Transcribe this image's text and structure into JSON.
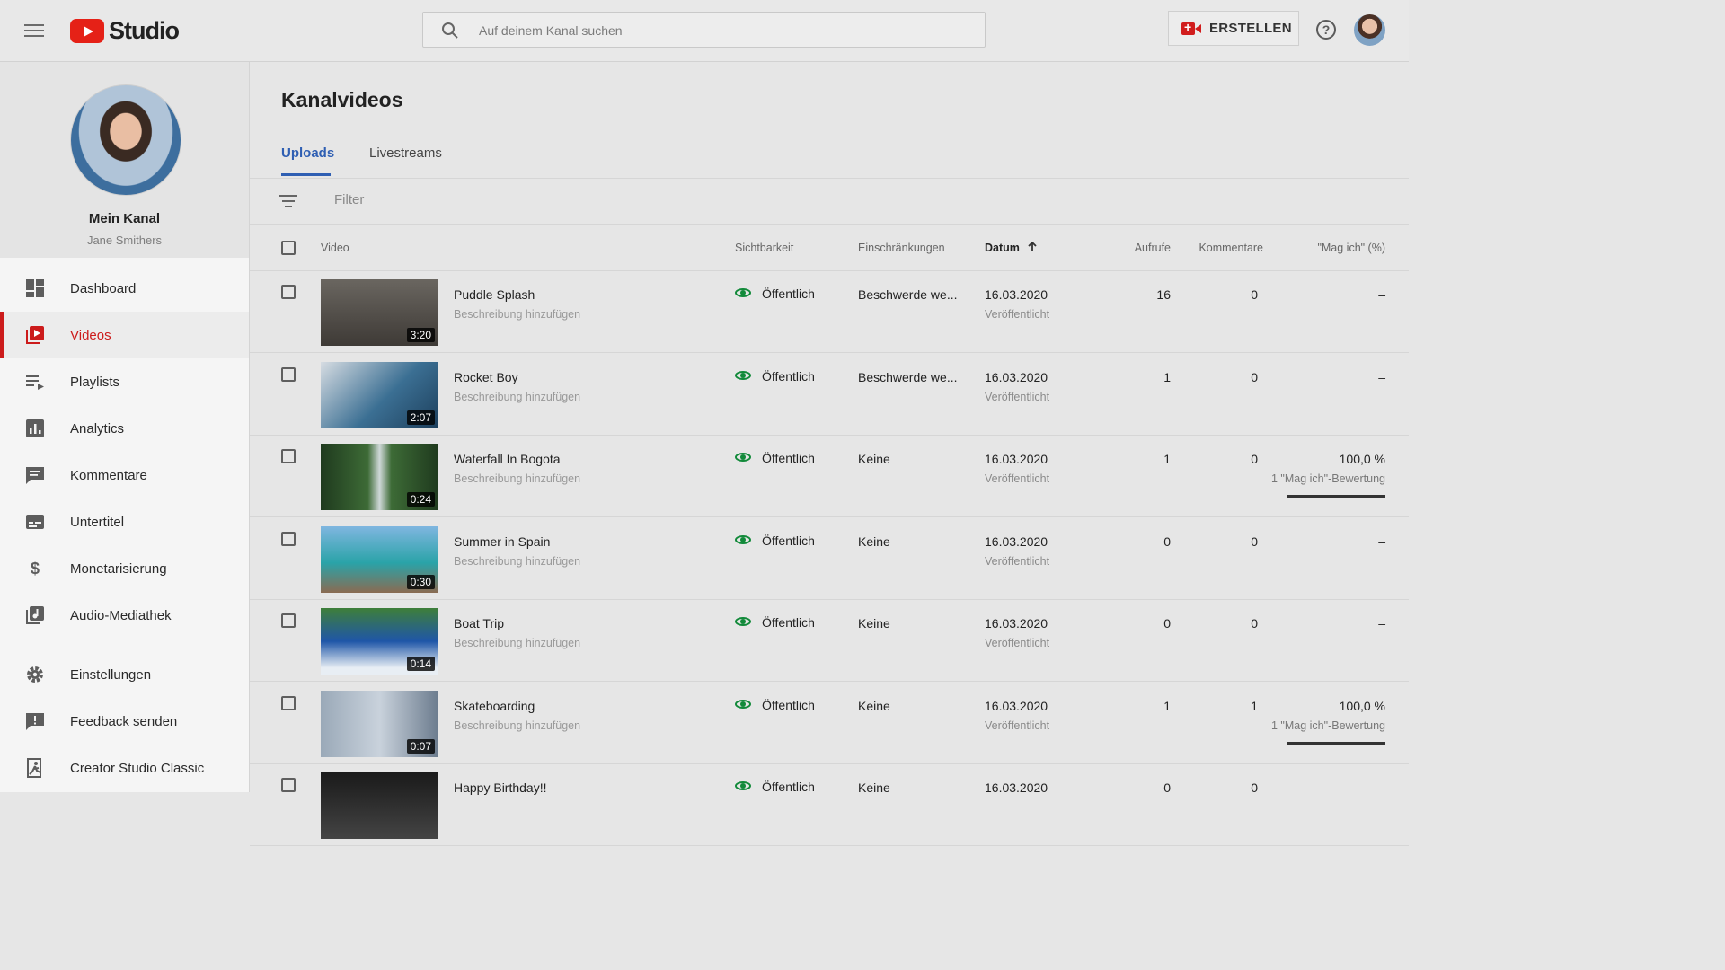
{
  "header": {
    "logo_text": "Studio",
    "search_placeholder": "Auf deinem Kanal suchen",
    "create_label": "ERSTELLEN",
    "help_glyph": "?"
  },
  "channel": {
    "name": "Mein Kanal",
    "owner": "Jane Smithers"
  },
  "sidebar": {
    "items": [
      {
        "label": "Dashboard",
        "icon": "dashboard-icon"
      },
      {
        "label": "Videos",
        "icon": "video-library-icon",
        "active": true
      },
      {
        "label": "Playlists",
        "icon": "playlist-icon"
      },
      {
        "label": "Analytics",
        "icon": "analytics-icon"
      },
      {
        "label": "Kommentare",
        "icon": "comment-icon"
      },
      {
        "label": "Untertitel",
        "icon": "subtitles-icon"
      },
      {
        "label": "Monetarisierung",
        "icon": "dollar-icon"
      },
      {
        "label": "Audio-Mediathek",
        "icon": "audio-library-icon"
      },
      {
        "label": "Einstellungen",
        "icon": "gear-icon"
      },
      {
        "label": "Feedback senden",
        "icon": "feedback-icon"
      },
      {
        "label": "Creator Studio Classic",
        "icon": "exit-icon"
      }
    ]
  },
  "main": {
    "title": "Kanalvideos",
    "tabs": [
      {
        "label": "Uploads",
        "active": true
      },
      {
        "label": "Livestreams"
      }
    ],
    "filter_placeholder": "Filter",
    "columns": {
      "video": "Video",
      "visibility": "Sichtbarkeit",
      "restrictions": "Einschränkungen",
      "date": "Datum",
      "views": "Aufrufe",
      "comments": "Kommentare",
      "likes": "\"Mag ich\" (%)"
    },
    "rows": [
      {
        "title": "Puddle Splash",
        "desc": "Beschreibung hinzufügen",
        "duration": "3:20",
        "visibility": "Öffentlich",
        "restrictions": "Beschwerde we...",
        "date": "16.03.2020",
        "status": "Veröffentlicht",
        "views": "16",
        "comments": "0",
        "likes": "–",
        "likes_sub": "",
        "like_ratio": null,
        "thumb": "#5a5450"
      },
      {
        "title": "Rocket Boy",
        "desc": "Beschreibung hinzufügen",
        "duration": "2:07",
        "visibility": "Öffentlich",
        "restrictions": "Beschwerde we...",
        "date": "16.03.2020",
        "status": "Veröffentlicht",
        "views": "1",
        "comments": "0",
        "likes": "–",
        "likes_sub": "",
        "like_ratio": null,
        "thumb": "#2f5c7c"
      },
      {
        "title": "Waterfall In Bogota",
        "desc": "Beschreibung hinzufügen",
        "duration": "0:24",
        "visibility": "Öffentlich",
        "restrictions": "Keine",
        "date": "16.03.2020",
        "status": "Veröffentlicht",
        "views": "1",
        "comments": "0",
        "likes": "100,0 %",
        "likes_sub": "1 \"Mag ich\"-Bewertung",
        "like_ratio": 1.0,
        "thumb": "#2d4a2a"
      },
      {
        "title": "Summer in Spain",
        "desc": "Beschreibung hinzufügen",
        "duration": "0:30",
        "visibility": "Öffentlich",
        "restrictions": "Keine",
        "date": "16.03.2020",
        "status": "Veröffentlicht",
        "views": "0",
        "comments": "0",
        "likes": "–",
        "likes_sub": "",
        "like_ratio": null,
        "thumb": "#2c8a9a"
      },
      {
        "title": "Boat Trip",
        "desc": "Beschreibung hinzufügen",
        "duration": "0:14",
        "visibility": "Öffentlich",
        "restrictions": "Keine",
        "date": "16.03.2020",
        "status": "Veröffentlicht",
        "views": "0",
        "comments": "0",
        "likes": "–",
        "likes_sub": "",
        "like_ratio": null,
        "thumb": "#1c4a8a"
      },
      {
        "title": "Skateboarding",
        "desc": "Beschreibung hinzufügen",
        "duration": "0:07",
        "visibility": "Öffentlich",
        "restrictions": "Keine",
        "date": "16.03.2020",
        "status": "Veröffentlicht",
        "views": "1",
        "comments": "1",
        "likes": "100,0 %",
        "likes_sub": "1 \"Mag ich\"-Bewertung",
        "like_ratio": 1.0,
        "thumb": "#7a8fa8"
      },
      {
        "title": "Happy Birthday!!",
        "desc": "",
        "duration": "",
        "visibility": "Öffentlich",
        "restrictions": "Keine",
        "date": "16.03.2020",
        "status": "",
        "views": "0",
        "comments": "0",
        "likes": "–",
        "likes_sub": "",
        "like_ratio": null,
        "thumb": "#1a1a1a"
      }
    ]
  }
}
